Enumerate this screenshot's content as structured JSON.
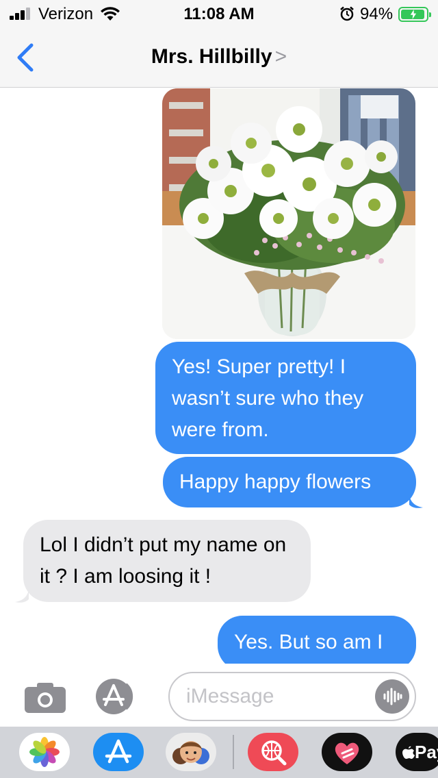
{
  "status_bar": {
    "carrier": "Verizon",
    "time": "11:08 AM",
    "battery_percent": "94%",
    "signal_bars": 3,
    "battery_level": 0.94,
    "charging": true,
    "alarm_set": true,
    "icons": [
      "signal-icon",
      "wifi-icon",
      "alarm-icon",
      "battery-charging-icon"
    ]
  },
  "nav": {
    "contact_name": "Mrs. Hillbilly",
    "chevron": ">",
    "back_icon": "back-chevron-icon"
  },
  "messages": [
    {
      "type": "image",
      "direction": "received",
      "description_icon": "flowers-photo"
    },
    {
      "type": "text",
      "direction": "sent",
      "text": "Yes! Super pretty! I wasn’t sure who they were from."
    },
    {
      "type": "text",
      "direction": "sent",
      "text": "Happy happy flowers"
    },
    {
      "type": "text",
      "direction": "received",
      "text": "Lol I didn’t put my name on it ? I am loosing it !"
    },
    {
      "type": "text",
      "direction": "sent",
      "text": "Yes. But so am I"
    }
  ],
  "input_bar": {
    "placeholder": "iMessage",
    "value": "",
    "icons": [
      "camera-icon",
      "app-store-icon",
      "audio-waveform-icon"
    ]
  },
  "app_drawer": {
    "apps": [
      "photos-app-icon",
      "app-store-app-icon",
      "memoji-app-icon",
      "web-search-app-icon",
      "digital-touch-app-icon",
      "apple-pay-app-icon"
    ],
    "pay_label": "Pay"
  },
  "colors": {
    "sent_bubble": "#3a8ef6",
    "received_bubble": "#e9e9eb",
    "accent": "#2f7cf6",
    "battery": "#34c759"
  }
}
